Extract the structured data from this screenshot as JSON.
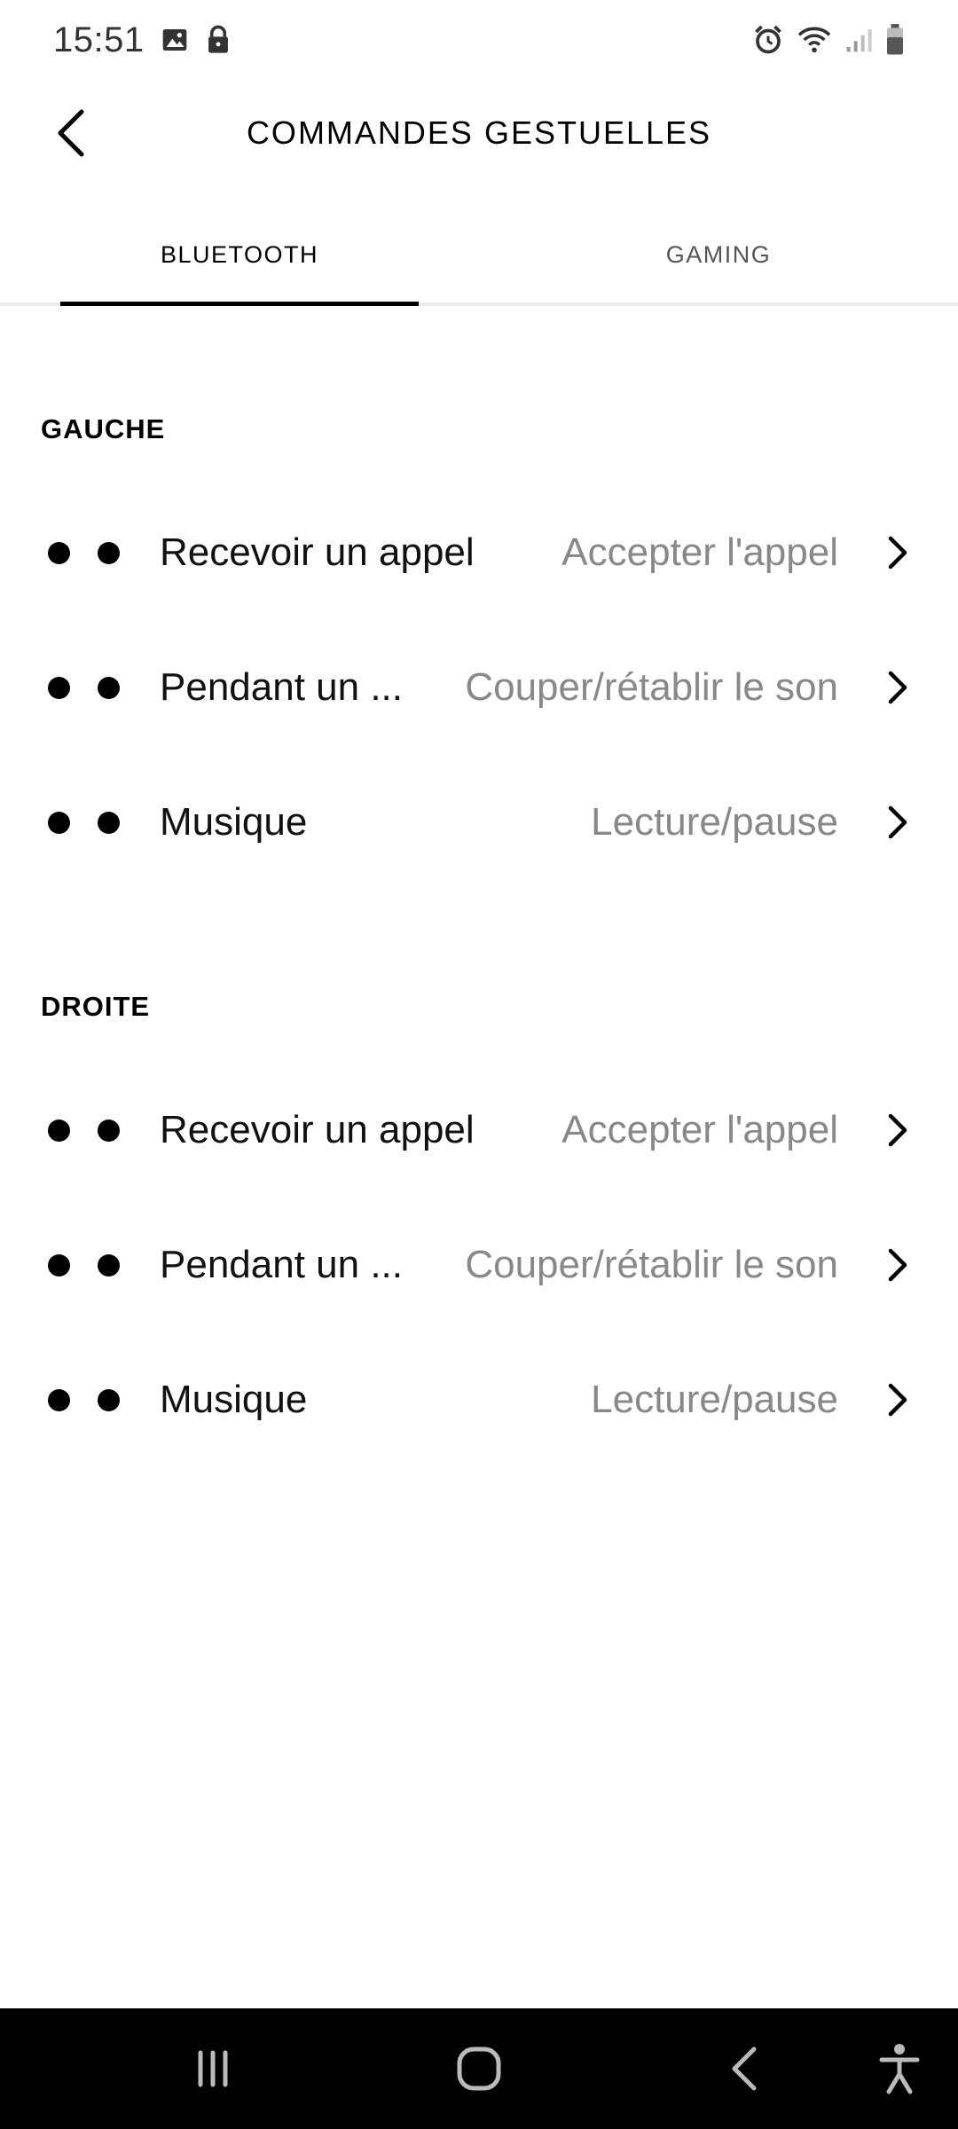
{
  "status_bar": {
    "time": "15:51",
    "icons_left": [
      "image-icon",
      "lock-icon"
    ],
    "icons_right": [
      "alarm-icon",
      "wifi-icon",
      "signal-icon",
      "battery-icon"
    ]
  },
  "header": {
    "title": "COMMANDES GESTUELLES",
    "back_icon": "back-arrow-icon"
  },
  "tabs": [
    {
      "label": "BLUETOOTH",
      "selected": true
    },
    {
      "label": "GAMING",
      "selected": false
    }
  ],
  "sections": [
    {
      "title": "GAUCHE",
      "rows": [
        {
          "label": "Recevoir un appel",
          "value": "Accepter l'appel"
        },
        {
          "label": "Pendant un ...",
          "value": "Couper/rétablir le son"
        },
        {
          "label": "Musique",
          "value": "Lecture/pause"
        }
      ]
    },
    {
      "title": "DROITE",
      "rows": [
        {
          "label": "Recevoir un appel",
          "value": "Accepter l'appel"
        },
        {
          "label": "Pendant un ...",
          "value": "Couper/rétablir le son"
        },
        {
          "label": "Musique",
          "value": "Lecture/pause"
        }
      ]
    }
  ],
  "nav_bar": {
    "buttons": [
      "recents-icon",
      "home-icon",
      "back-icon",
      "accessibility-icon"
    ]
  },
  "colors": {
    "text_primary": "#000000",
    "text_secondary": "#888888",
    "nav_background": "#000000",
    "tab_divider": "#ececec"
  }
}
